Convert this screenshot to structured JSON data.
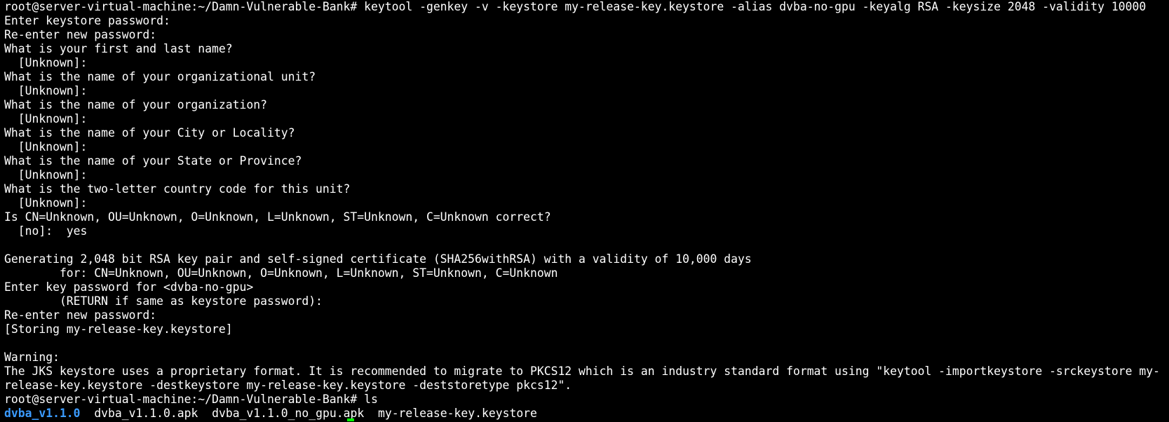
{
  "terminal": {
    "lines": [
      "root@server-virtual-machine:~/Damn-Vulnerable-Bank# keytool -genkey -v -keystore my-release-key.keystore -alias dvba-no-gpu -keyalg RSA -keysize 2048 -validity 10000",
      "Enter keystore password:",
      "Re-enter new password:",
      "What is your first and last name?",
      "  [Unknown]:",
      "What is the name of your organizational unit?",
      "  [Unknown]:",
      "What is the name of your organization?",
      "  [Unknown]:",
      "What is the name of your City or Locality?",
      "  [Unknown]:",
      "What is the name of your State or Province?",
      "  [Unknown]:",
      "What is the two-letter country code for this unit?",
      "  [Unknown]:",
      "Is CN=Unknown, OU=Unknown, O=Unknown, L=Unknown, ST=Unknown, C=Unknown correct?",
      "  [no]:  yes",
      "",
      "Generating 2,048 bit RSA key pair and self-signed certificate (SHA256withRSA) with a validity of 10,000 days",
      "        for: CN=Unknown, OU=Unknown, O=Unknown, L=Unknown, ST=Unknown, C=Unknown",
      "Enter key password for <dvba-no-gpu>",
      "        (RETURN if same as keystore password):",
      "Re-enter new password:",
      "[Storing my-release-key.keystore]",
      "",
      "Warning:",
      "The JKS keystore uses a proprietary format. It is recommended to migrate to PKCS12 which is an industry standard format using \"keytool -importkeystore -srckeystore my-",
      "release-key.keystore -destkeystore my-release-key.keystore -deststoretype pkcs12\".",
      "root@server-virtual-machine:~/Damn-Vulnerable-Bank# ls"
    ],
    "ls_output": {
      "dir": "dvba_v1.1.0",
      "files": [
        "dvba_v1.1.0.apk",
        "dvba_v1.1.0_no_gpu.apk",
        "my-release-key.keystore"
      ]
    },
    "colors": {
      "background": "#000000",
      "foreground": "#ffffff",
      "directory": "#3b9bff",
      "cursor": "#00ff00"
    }
  }
}
